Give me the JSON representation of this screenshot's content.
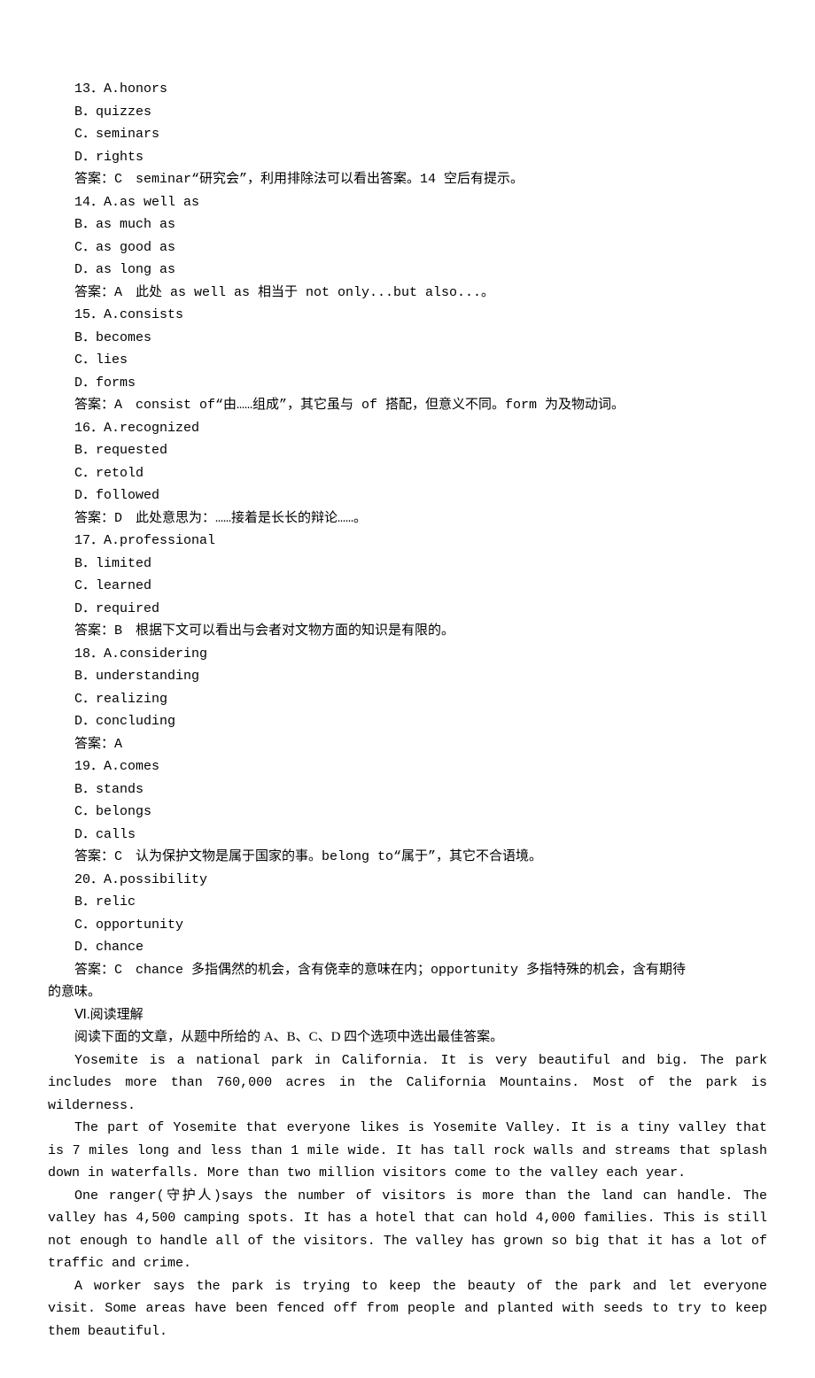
{
  "questions": [
    {
      "num": "13．",
      "lead": "A.honors",
      "opts": [
        "B．quizzes",
        "C．seminars",
        "D．rights"
      ],
      "answer": "答案：C　seminar“研究会”，利用排除法可以看出答案。14 空后有提示。"
    },
    {
      "num": "14．",
      "lead": "A.as well as",
      "opts": [
        "B．as much as",
        "C．as good as",
        "D．as long as"
      ],
      "answer": "答案：A　此处 as well as 相当于 not only...but also...。"
    },
    {
      "num": "15．",
      "lead": "A.consists",
      "opts": [
        "B．becomes",
        "C．lies",
        "D．forms"
      ],
      "answer": "答案：A　consist of“由……组成”，其它虽与 of 搭配，但意义不同。form 为及物动词。"
    },
    {
      "num": "16．",
      "lead": "A.recognized",
      "opts": [
        "B．requested",
        "C．retold",
        "D．followed"
      ],
      "answer": "答案：D　此处意思为：……接着是长长的辩论……。"
    },
    {
      "num": "17．",
      "lead": "A.professional",
      "opts": [
        "B．limited",
        "C．learned",
        "D．required"
      ],
      "answer": "答案：B　根据下文可以看出与会者对文物方面的知识是有限的。"
    },
    {
      "num": "18．",
      "lead": "A.considering",
      "opts": [
        "B．understanding",
        "C．realizing",
        "D．concluding"
      ],
      "answer": "答案：A"
    },
    {
      "num": "19．",
      "lead": "A.comes",
      "opts": [
        "B．stands",
        "C．belongs",
        "D．calls"
      ],
      "answer": "答案：C　认为保护文物是属于国家的事。belong to“属于”，其它不合语境。"
    },
    {
      "num": "20．",
      "lead": "A.possibility",
      "opts": [
        "B．relic",
        "C．opportunity",
        "D．chance"
      ],
      "answer": "答案：C　chance 多指偶然的机会，含有侥幸的意味在内；opportunity 多指特殊的机会，含有期待的意味。",
      "answer_flush": true
    }
  ],
  "reading": {
    "section": "Ⅵ.阅读理解",
    "instruction": "阅读下面的文章，从题中所给的 A、B、C、D 四个选项中选出最佳答案。",
    "paragraphs": [
      "Yosemite is a national park in California. It is very beautiful and big. The park includes more than 760,000 acres in the California Mountains. Most of the park is wilderness.",
      "The part of Yosemite that everyone likes is Yosemite Valley. It is a tiny valley that is 7 miles long and less than 1 mile wide. It has tall rock walls and streams that splash down in waterfalls. More than two million visitors come to the valley each year.",
      "One ranger(守护人)says the number of visitors is more than the land can handle. The valley has 4,500 camping spots. It has a hotel that can hold 4,000 families. This is still not enough to handle all of the visitors. The valley has grown so big that it has a lot of traffic and crime.",
      "A worker says the park is trying to keep the beauty of the park and let everyone visit. Some areas have been fenced off from people and planted with seeds to try to keep them beautiful."
    ]
  }
}
